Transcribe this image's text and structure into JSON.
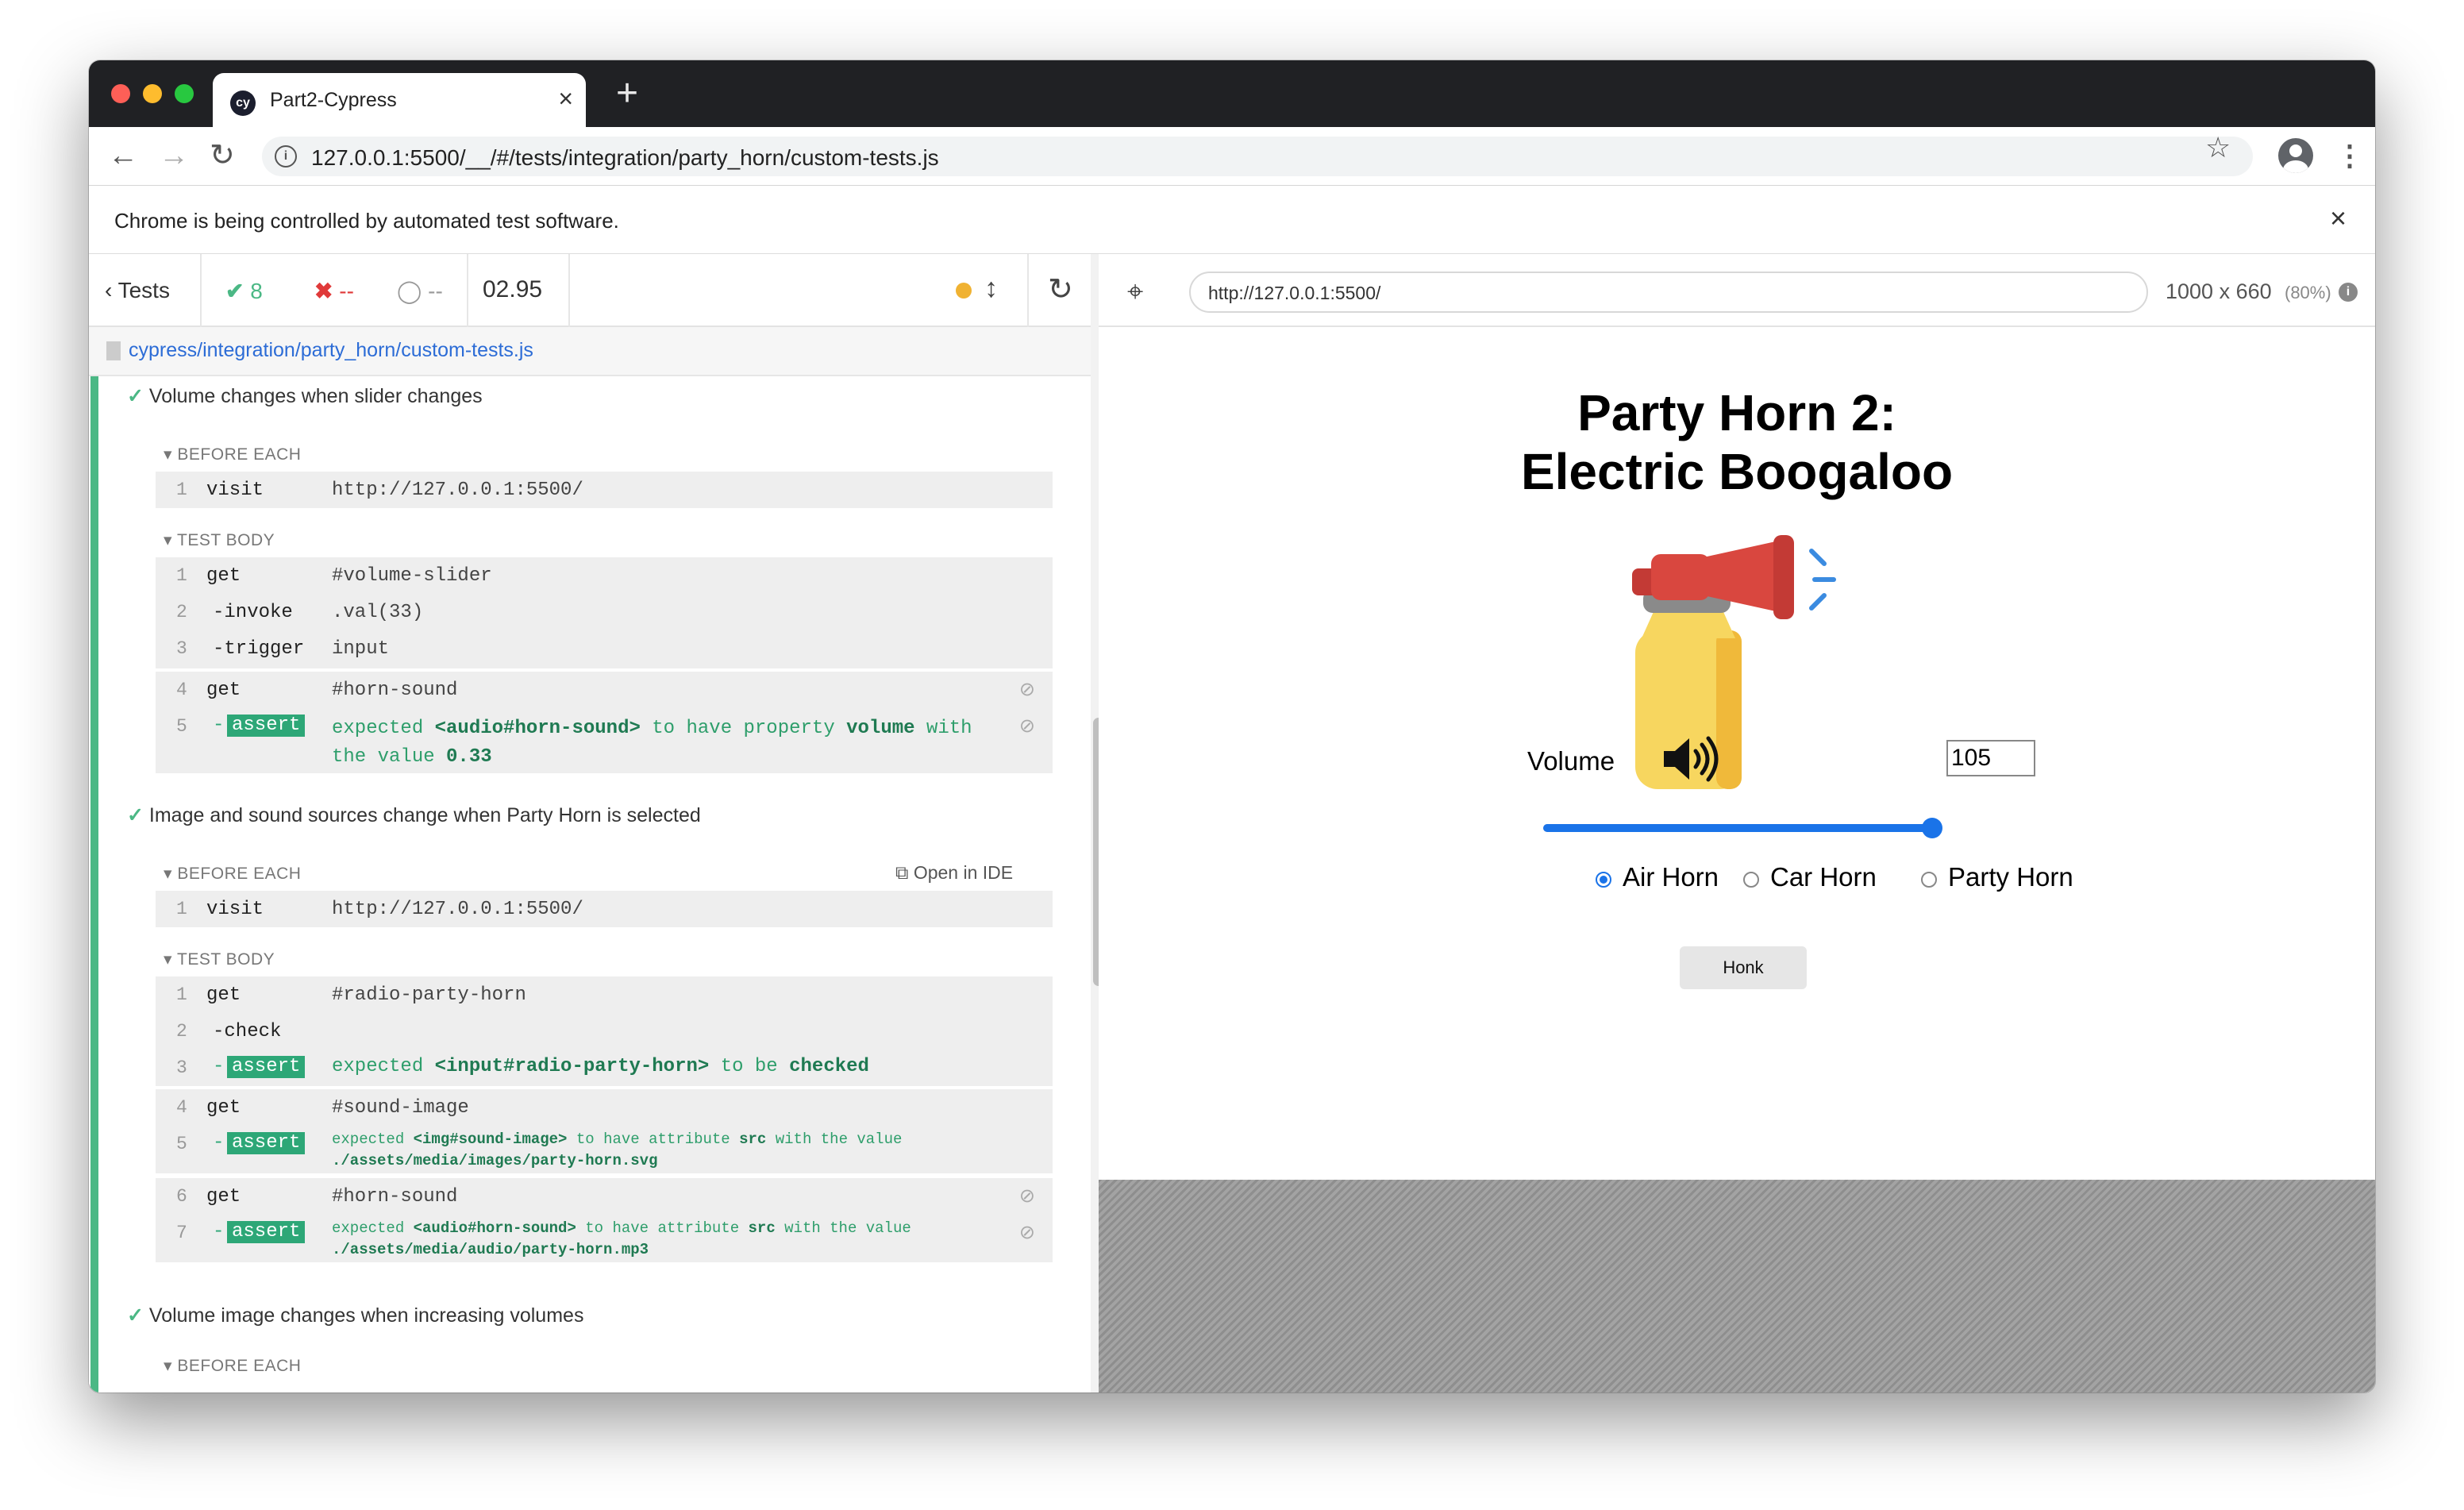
{
  "browser": {
    "tab_title": "Part2-Cypress",
    "tab_favicon": "cy",
    "new_tab": "+",
    "url": "127.0.0.1:5500/__/#/tests/integration/party_horn/custom-tests.js",
    "automation_notice": "Chrome is being controlled by automated test software."
  },
  "reporter": {
    "tests_label": "Tests",
    "passed": "8",
    "failed": "--",
    "pending": "--",
    "duration": "02.95",
    "spec_path": "cypress/integration/party_horn/custom-tests.js",
    "open_in_ide": "Open in IDE",
    "tests": [
      {
        "title": "Volume changes when slider changes",
        "before_each_label": "BEFORE EACH",
        "before_each": [
          {
            "num": "1",
            "name": "visit",
            "value": "http://127.0.0.1:5500/"
          }
        ],
        "test_body_label": "TEST BODY",
        "body": [
          {
            "num": "1",
            "name": "get",
            "value": "#volume-slider"
          },
          {
            "num": "2",
            "name": "-invoke",
            "value": ".val(33)"
          },
          {
            "num": "3",
            "name": "-trigger",
            "value": "input"
          },
          {
            "num": "4",
            "name": "get",
            "value": "#horn-sound"
          },
          {
            "num": "5",
            "name": "-assert",
            "value": "expected <audio#horn-sound> to have property volume with the value 0.33",
            "parts": [
              "expected",
              "<audio#horn-sound>",
              "to have property",
              "volume",
              "with",
              "the value",
              "0.33"
            ]
          }
        ]
      },
      {
        "title": "Image and sound sources change when Party Horn is selected",
        "before_each_label": "BEFORE EACH",
        "before_each": [
          {
            "num": "1",
            "name": "visit",
            "value": "http://127.0.0.1:5500/"
          }
        ],
        "test_body_label": "TEST BODY",
        "body": [
          {
            "num": "1",
            "name": "get",
            "value": "#radio-party-horn"
          },
          {
            "num": "2",
            "name": "-check",
            "value": ""
          },
          {
            "num": "3",
            "name": "-assert",
            "value": "expected <input#radio-party-horn> to be checked",
            "parts": [
              "expected",
              "<input#radio-party-horn>",
              "to be",
              "checked"
            ]
          },
          {
            "num": "4",
            "name": "get",
            "value": "#sound-image"
          },
          {
            "num": "5",
            "name": "-assert",
            "value": "expected <img#sound-image> to have attribute src with the value ./assets/media/images/party-horn.svg",
            "parts": [
              "expected",
              "<img#sound-image>",
              "to have attribute",
              "src",
              "with the value",
              "./assets/media/images/party-horn.svg"
            ]
          },
          {
            "num": "6",
            "name": "get",
            "value": "#horn-sound"
          },
          {
            "num": "7",
            "name": "-assert",
            "value": "expected <audio#horn-sound> to have attribute src with the value ./assets/media/audio/party-horn.mp3",
            "parts": [
              "expected",
              "<audio#horn-sound>",
              "to have attribute",
              "src",
              "with the value",
              "./assets/media/audio/party-horn.mp3"
            ]
          }
        ]
      },
      {
        "title": "Volume image changes when increasing volumes",
        "before_each_label": "BEFORE EACH"
      }
    ]
  },
  "aut": {
    "url": "http://127.0.0.1:5500/",
    "viewport": "1000 x 660",
    "scale": "(80%)",
    "page": {
      "title_line1": "Party Horn 2:",
      "title_line2": "Electric Boogaloo",
      "volume_label": "Volume",
      "volume_value": "105",
      "slider_fraction": 1.0,
      "radios": [
        {
          "label": "Air Horn",
          "checked": true
        },
        {
          "label": "Car Horn",
          "checked": false
        },
        {
          "label": "Party Horn",
          "checked": false
        }
      ],
      "honk_label": "Honk"
    }
  },
  "colors": {
    "pass_green": "#4bb885",
    "fail_red": "#e03a3a",
    "link_blue": "#2c6cd6",
    "running_orange": "#f0b232",
    "slider_blue": "#1a73e8"
  },
  "icons": [
    "back-arrow-icon",
    "forward-arrow-icon",
    "reload-icon",
    "info-icon",
    "star-icon",
    "profile-icon",
    "kebab-menu-icon",
    "close-icon",
    "check-icon",
    "x-icon",
    "spinner-icon",
    "crosshair-icon",
    "eye-slash-icon",
    "external-link-icon",
    "speaker-icon",
    "air-horn-icon"
  ]
}
